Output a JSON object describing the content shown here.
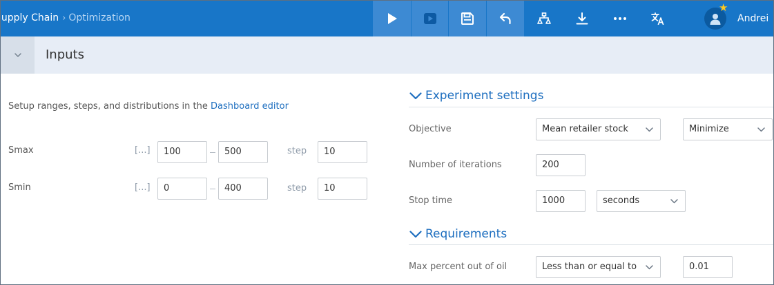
{
  "breadcrumb": {
    "root": "Supply Chain",
    "separator": "›",
    "current": "Optimization"
  },
  "toolbar": {
    "icons": [
      "play-icon",
      "run-animation-icon",
      "save-icon",
      "undo-icon",
      "hierarchy-icon",
      "download-icon",
      "more-icon",
      "translate-icon"
    ],
    "accent": "#1876c8",
    "active_bg": "#3d8ad3"
  },
  "user": {
    "name": "Andrei",
    "star": "★"
  },
  "inputs": {
    "title": "Inputs"
  },
  "hint": {
    "prefix": "Setup ranges, steps, and distributions in the ",
    "link": "Dashboard editor"
  },
  "params": [
    {
      "name": "Smax",
      "ellipsis": "[...]",
      "min": "100",
      "max": "500",
      "step_label": "step",
      "step": "10"
    },
    {
      "name": "Smin",
      "ellipsis": "[...]",
      "min": "0",
      "max": "400",
      "step_label": "step",
      "step": "10"
    }
  ],
  "experiment": {
    "title": "Experiment settings",
    "objective_label": "Objective",
    "objective_value": "Mean retailer stock",
    "objective_direction": "Minimize",
    "iterations_label": "Number of iterations",
    "iterations_value": "200",
    "stop_time_label": "Stop time",
    "stop_time_value": "1000",
    "stop_time_unit": "seconds"
  },
  "requirements": {
    "title": "Requirements",
    "label": "Max percent out of oil",
    "condition": "Less than or equal to",
    "value": "0.01"
  }
}
